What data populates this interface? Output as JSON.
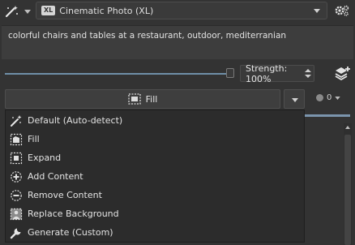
{
  "toolbar": {
    "style_badge": "XL",
    "style_name": "Cinematic Photo (XL)"
  },
  "prompt": {
    "text": "colorful chairs and tables at a restaurant, outdoor, mediterranian"
  },
  "strength": {
    "label": "Strength: 100%",
    "value_percent": 100
  },
  "generate": {
    "button_label": "Fill",
    "queue_count": "0"
  },
  "menu": {
    "items": [
      {
        "label": "Default (Auto-detect)",
        "icon": "magic-wand-icon"
      },
      {
        "label": "Fill",
        "icon": "fill-icon"
      },
      {
        "label": "Expand",
        "icon": "expand-icon"
      },
      {
        "label": "Add Content",
        "icon": "add-content-icon"
      },
      {
        "label": "Remove Content",
        "icon": "remove-content-icon"
      },
      {
        "label": "Replace Background",
        "icon": "replace-background-icon"
      },
      {
        "label": "Generate (Custom)",
        "icon": "generate-custom-icon"
      }
    ]
  },
  "colors": {
    "background": "#333333",
    "accent": "#7b95ad"
  }
}
